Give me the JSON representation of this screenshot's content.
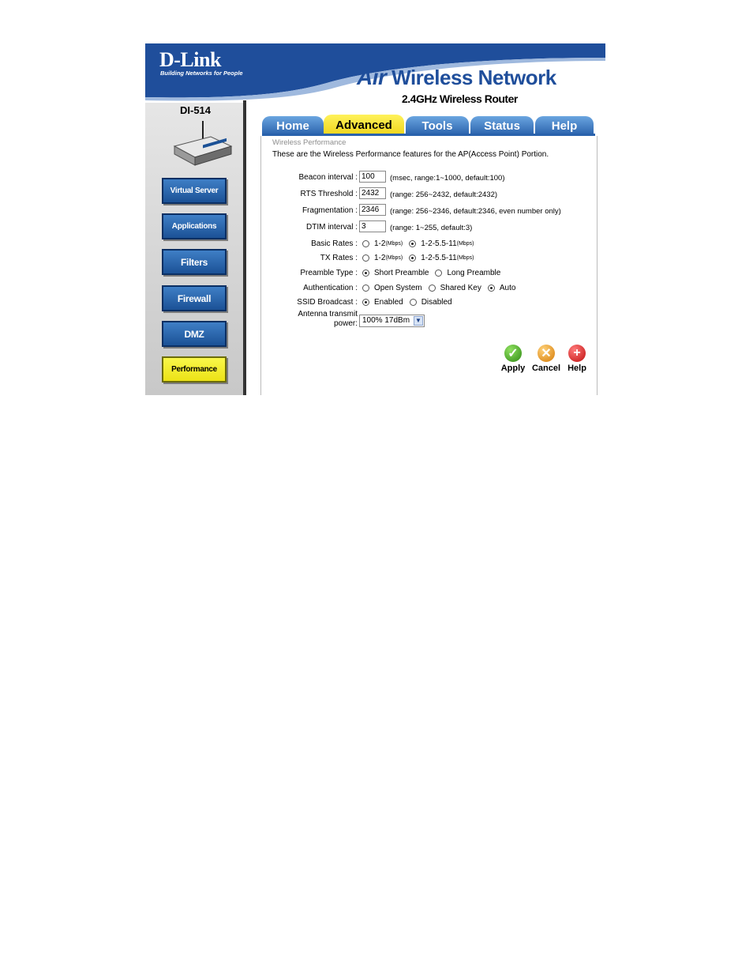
{
  "brand": {
    "logo": "D-Link",
    "tagline": "Building Networks for People"
  },
  "header": {
    "title_air": "Air",
    "title_rest": "Wireless Network",
    "subtitle": "2.4GHz Wireless Router"
  },
  "model": "DI-514",
  "sidebar": {
    "items": [
      {
        "label": "Virtual Server",
        "active": false
      },
      {
        "label": "Applications",
        "active": false
      },
      {
        "label": "Filters",
        "active": false
      },
      {
        "label": "Firewall",
        "active": false
      },
      {
        "label": "DMZ",
        "active": false
      },
      {
        "label": "Performance",
        "active": true
      }
    ]
  },
  "tabs": [
    {
      "label": "Home",
      "active": false
    },
    {
      "label": "Advanced",
      "active": true
    },
    {
      "label": "Tools",
      "active": false
    },
    {
      "label": "Status",
      "active": false
    },
    {
      "label": "Help",
      "active": false
    }
  ],
  "content": {
    "section_title": "Wireless Performance",
    "description": "These are the Wireless Performance features for the AP(Access Point) Portion.",
    "beacon": {
      "label": "Beacon interval :",
      "value": "100",
      "hint": "(msec, range:1~1000, default:100)"
    },
    "rts": {
      "label": "RTS Threshold :",
      "value": "2432",
      "hint": "(range: 256~2432, default:2432)"
    },
    "frag": {
      "label": "Fragmentation :",
      "value": "2346",
      "hint": "(range: 256~2346, default:2346, even number only)"
    },
    "dtim": {
      "label": "DTIM interval :",
      "value": "3",
      "hint": "(range: 1~255, default:3)"
    },
    "basic_rates": {
      "label": "Basic Rates :",
      "opt1": "1-2",
      "opt2": "1-2-5.5-11",
      "unit": "(Mbps)",
      "selected": 2
    },
    "tx_rates": {
      "label": "TX Rates :",
      "opt1": "1-2",
      "opt2": "1-2-5.5-11",
      "unit": "(Mbps)",
      "selected": 2
    },
    "preamble": {
      "label": "Preamble Type :",
      "opt1": "Short Preamble",
      "opt2": "Long Preamble",
      "selected": 1
    },
    "auth": {
      "label": "Authentication :",
      "opt1": "Open System",
      "opt2": "Shared Key",
      "opt3": "Auto",
      "selected": 3
    },
    "ssid": {
      "label": "SSID Broadcast :",
      "opt1": "Enabled",
      "opt2": "Disabled",
      "selected": 1
    },
    "antenna": {
      "label_line1": "Antenna transmit",
      "label_line2": "power:",
      "value": "100% 17dBm"
    }
  },
  "actions": {
    "apply": "Apply",
    "cancel": "Cancel",
    "help": "Help"
  },
  "colors": {
    "brand_blue": "#1f4e9b",
    "tab_blue": "#2a62ac",
    "active_yellow": "#f0d51c",
    "apply_green": "#3a9a1e",
    "cancel_orange": "#e08a10",
    "help_red": "#d01a1a"
  }
}
